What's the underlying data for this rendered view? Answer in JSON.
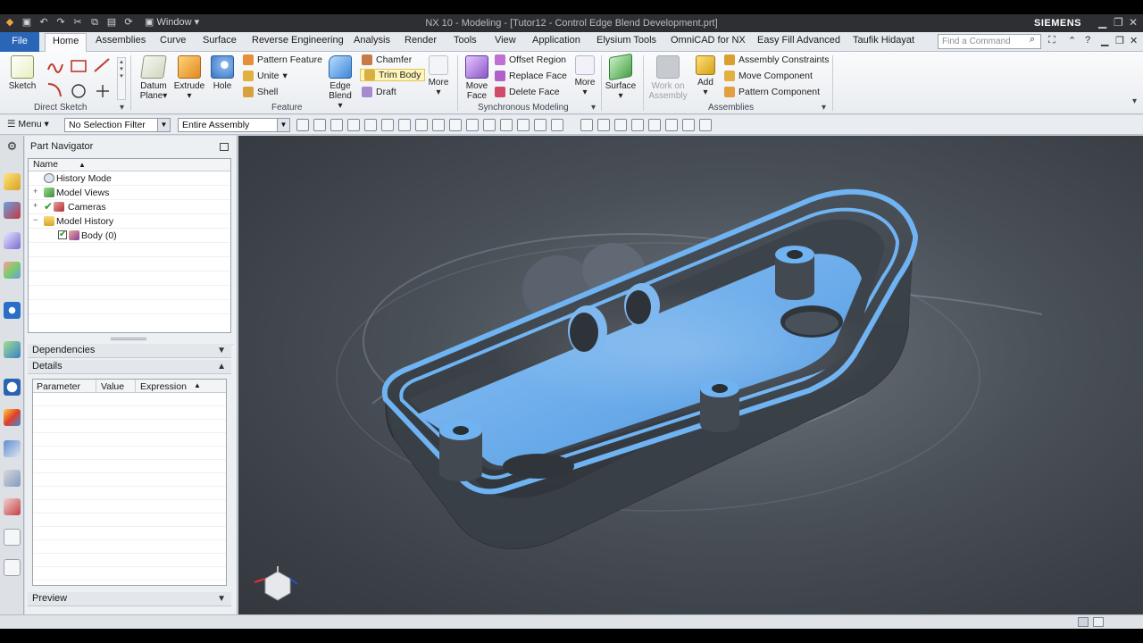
{
  "window": {
    "title": "NX 10 - Modeling - [Tutor12 - Control Edge Blend Development.prt]",
    "brand": "SIEMENS",
    "window_menu": "Window"
  },
  "tabs": {
    "file": "File",
    "items": [
      "Home",
      "Assemblies",
      "Curve",
      "Surface",
      "Reverse Engineering",
      "Analysis",
      "Render",
      "Tools",
      "View",
      "Application",
      "Elysium Tools",
      "OmniCAD for NX",
      "Easy Fill Advanced",
      "Taufik Hidayat"
    ],
    "search_placeholder": "Find a Command"
  },
  "ribbon": {
    "direct_sketch": {
      "sketch": "Sketch",
      "label": "Direct Sketch"
    },
    "feature": {
      "datum_plane": "Datum Plane",
      "extrude": "Extrude",
      "hole": "Hole",
      "pattern_feature": "Pattern Feature",
      "unite": "Unite",
      "shell": "Shell",
      "edge_blend": "Edge Blend",
      "chamfer": "Chamfer",
      "trim_body": "Trim Body",
      "draft": "Draft",
      "more": "More",
      "label": "Feature"
    },
    "sync": {
      "move_face": "Move Face",
      "offset_region": "Offset Region",
      "replace_face": "Replace Face",
      "delete_face": "Delete Face",
      "more": "More",
      "label": "Synchronous Modeling"
    },
    "surface": {
      "surface": "Surface"
    },
    "assemblies": {
      "work_on_assembly": "Work on Assembly",
      "add": "Add",
      "assembly_constraints": "Assembly Constraints",
      "move_component": "Move Component",
      "pattern_component": "Pattern Component",
      "label": "Assemblies"
    }
  },
  "selection_bar": {
    "menu": "Menu",
    "filter": "No Selection Filter",
    "scope": "Entire Assembly"
  },
  "navigator": {
    "title": "Part Navigator",
    "column_name": "Name",
    "nodes": [
      "History Mode",
      "Model Views",
      "Cameras",
      "Model History",
      "Body (0)"
    ],
    "dependencies": "Dependencies",
    "details": "Details",
    "details_columns": [
      "Parameter",
      "Value",
      "Expression"
    ],
    "preview": "Preview"
  },
  "colors": {
    "part_face": "#5fa8ec",
    "part_wall": "#3b4148",
    "file_tab": "#2a66b7"
  }
}
